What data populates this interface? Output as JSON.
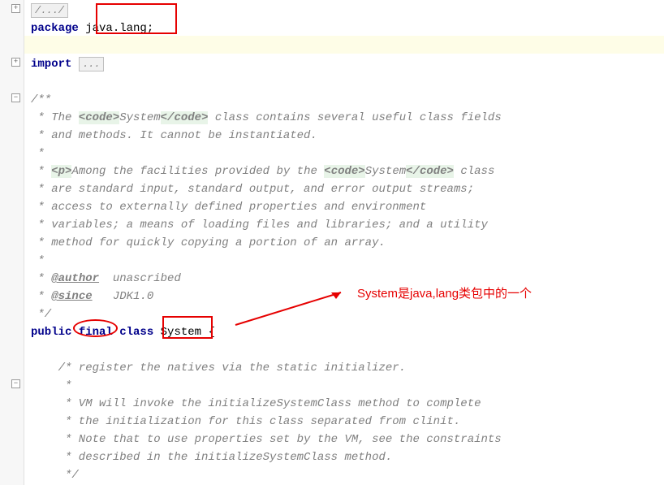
{
  "code": {
    "fold1": "/.../",
    "package_kw": "package",
    "package_name": " java.lang;",
    "import_kw": "import",
    "import_dots": "...",
    "doc_open": "/**",
    "doc_l1a": " * The ",
    "doc_l1b": "<code>",
    "doc_l1c": "System",
    "doc_l1d": "</code>",
    "doc_l1e": " class contains several useful class fields",
    "doc_l2": " * and methods. It cannot be instantiated.",
    "doc_l3": " *",
    "doc_l4a": " * ",
    "doc_l4b": "<p>",
    "doc_l4c": "Among the facilities provided by the ",
    "doc_l4d": "<code>",
    "doc_l4e": "System",
    "doc_l4f": "</code>",
    "doc_l4g": " class",
    "doc_l5": " * are standard input, standard output, and error output streams;",
    "doc_l6": " * access to externally defined properties and environment",
    "doc_l7": " * variables; a means of loading files and libraries; and a utility",
    "doc_l8": " * method for quickly copying a portion of an array.",
    "doc_l9": " *",
    "doc_author_tag": "@author",
    "doc_author_val": "  unascribed",
    "doc_since_tag": "@since",
    "doc_since_val": "   JDK1.0",
    "doc_close": " */",
    "public_kw": "public ",
    "final_kw": "final",
    "class_kw": " class ",
    "class_name": "System",
    "class_open": " {",
    "inner_pad": "    ",
    "inner_c1": "/* register the natives via the static initializer.",
    "inner_c2": "     *",
    "inner_c3": "     * VM will invoke the initializeSystemClass method to complete",
    "inner_c4": "     * the initialization for this class separated from clinit.",
    "inner_c5": "     * Note that to use properties set by the VM, see the constraints",
    "inner_c6": "     * described in the initializeSystemClass method.",
    "inner_c7": "     */"
  },
  "annotation": {
    "text": "System是java,lang类包中的一个"
  }
}
